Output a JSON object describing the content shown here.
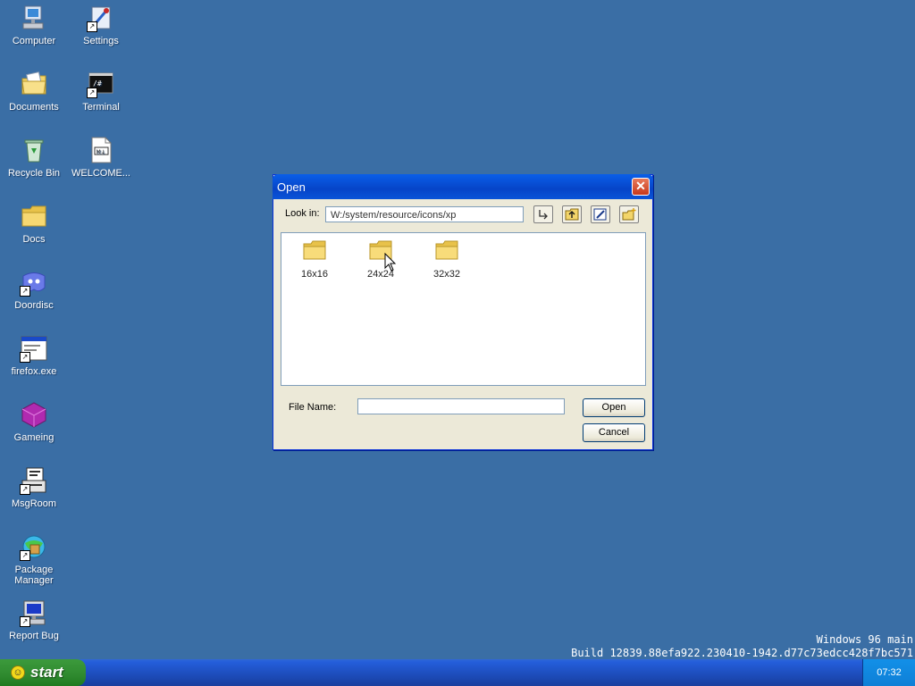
{
  "desktop": {
    "icons": [
      {
        "label": "Computer"
      },
      {
        "label": "Settings"
      },
      {
        "label": "Documents"
      },
      {
        "label": "Terminal"
      },
      {
        "label": "Recycle Bin"
      },
      {
        "label": "WELCOME..."
      },
      {
        "label": "Docs"
      },
      {
        "label": "Doordisc"
      },
      {
        "label": "firefox.exe"
      },
      {
        "label": "Gameing"
      },
      {
        "label": "MsgRoom"
      },
      {
        "label": "Package Manager"
      },
      {
        "label": "Report Bug"
      }
    ]
  },
  "dialog": {
    "title": "Open",
    "close_glyph": "✕",
    "look_in_label": "Look in:",
    "look_in_value": "W:/system/resource/icons/xp",
    "toolbar": {
      "go_icon": "enter-arrow-icon",
      "up_icon": "folder-up-icon",
      "rename_icon": "edit-icon",
      "new_folder_icon": "new-folder-icon"
    },
    "files": [
      {
        "name": "16x16",
        "icon": "folder-icon"
      },
      {
        "name": "24x24",
        "icon": "folder-icon"
      },
      {
        "name": "32x32",
        "icon": "folder-icon"
      }
    ],
    "file_name_label": "File Name:",
    "file_name_value": "",
    "open_label": "Open",
    "cancel_label": "Cancel"
  },
  "build_info": {
    "line1": "Windows 96 main",
    "line2": "Build 12839.88efa922.230410-1942.d77c73edcc428f7bc571"
  },
  "taskbar": {
    "start_label": "start",
    "clock": "07:32"
  },
  "colors": {
    "desktop": "#3a6ea5",
    "titlebar": "#0a5fe8",
    "taskbar": "#245edb",
    "start": "#2f8a2f"
  }
}
